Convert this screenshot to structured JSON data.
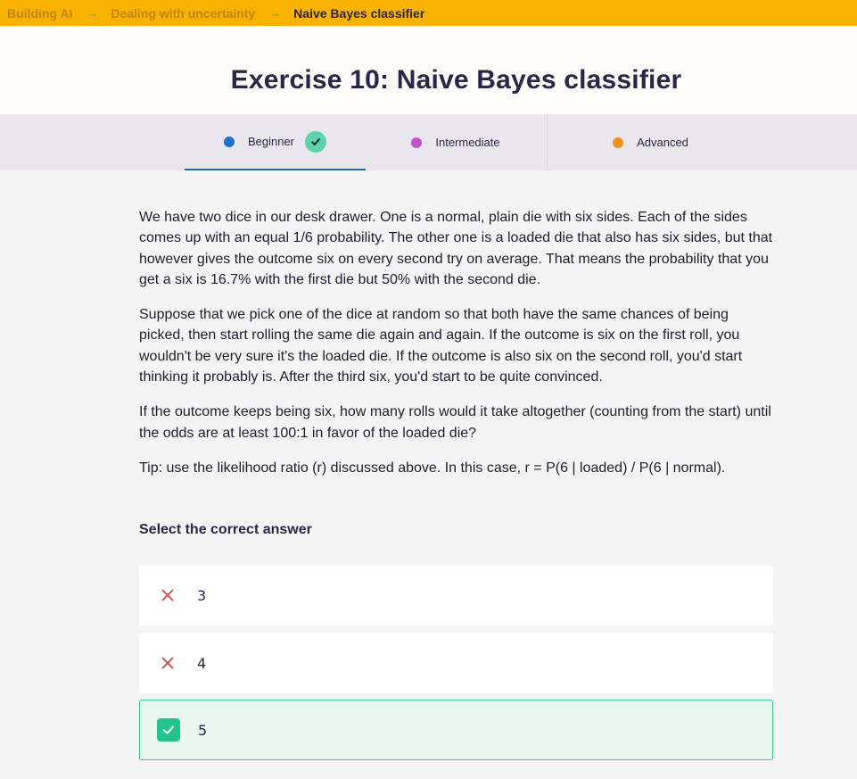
{
  "breadcrumb": {
    "items": [
      "Building AI",
      "Dealing with uncertainty"
    ],
    "current": "Naive Bayes classifier",
    "separator": "→"
  },
  "page": {
    "title": "Exercise 10: Naive Bayes classifier"
  },
  "tabs": [
    {
      "label": "Beginner",
      "color": "#1c72c8",
      "completed": true,
      "active": true
    },
    {
      "label": "Intermediate",
      "color": "#c053c9"
    },
    {
      "label": "Advanced",
      "color": "#f0931c"
    }
  ],
  "exercise": {
    "paragraphs": [
      "We have two dice in our desk drawer. One is a normal, plain die with six sides. Each of the sides comes up with an equal 1/6 probability. The other one is a loaded die that also has six sides, but that however gives the outcome six on every second try on average. That means the probability that you get a six is 16.7% with the first die but 50% with the second die.",
      "Suppose that we pick one of the dice at random so that both have the same chances of being picked, then start rolling the same die again and again. If the outcome is six on the first roll, you wouldn't be very sure it's the loaded die. If the outcome is also six on the second roll, you'd start thinking it probably is. After the third six, you'd start to be quite convinced.",
      "If the outcome keeps being six, how many rolls would it take altogether (counting from the start) until the odds are at least 100:1 in favor of the loaded die?",
      "Tip: use the likelihood ratio (r) discussed above. In this case, r = P(6 | loaded) / P(6 | normal)."
    ],
    "answer_heading": "Select the correct answer",
    "options": [
      {
        "label": "3",
        "state": "incorrect"
      },
      {
        "label": "4",
        "state": "incorrect"
      },
      {
        "label": "5",
        "state": "correct"
      }
    ]
  },
  "colors": {
    "accent_yellow": "#f9b200",
    "correct_green": "#26c28d",
    "incorrect_red": "#d9443b"
  }
}
